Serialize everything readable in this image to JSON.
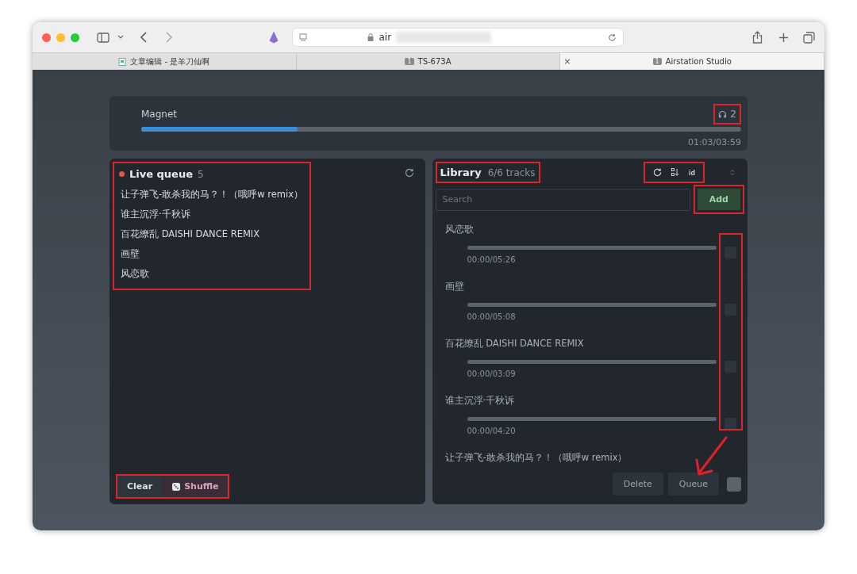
{
  "browser": {
    "address": "air",
    "tabs": [
      {
        "title": "文章编辑 - 是羊刀仙啊",
        "selected": false
      },
      {
        "title": "TS-673A",
        "selected": false,
        "badge": "1"
      },
      {
        "title": "Airstation Studio",
        "selected": true,
        "badge": "1",
        "close": "×"
      }
    ]
  },
  "player": {
    "title": "Magnet",
    "listeners": "2",
    "level": 0.26,
    "time": "01:03/03:59"
  },
  "queue": {
    "title": "Live queue",
    "live": true,
    "count": "5",
    "items": [
      "让子弹飞-敢杀我的马？！（哦呼w remix）",
      "谁主沉浮·千秋诉",
      "百花缭乱 DAISHI DANCE REMIX",
      "画壁",
      "风恋歌"
    ],
    "buttons": [
      "Clear",
      "Shuffle"
    ]
  },
  "library": {
    "title": "Library",
    "count": "6/6 tracks",
    "sort_label": "id",
    "search": {
      "placeholder": "Search"
    },
    "add_button": "Add",
    "tracks": [
      {
        "name": "风恋歌",
        "time": "00:00/05:26",
        "level": 0,
        "checked": false
      },
      {
        "name": "画壁",
        "time": "00:00/05:08",
        "level": 0,
        "checked": false
      },
      {
        "name": "百花缭乱 DAISHI DANCE REMIX",
        "time": "00:00/03:09",
        "level": 0,
        "checked": false
      },
      {
        "name": "谁主沉浮·千秋诉",
        "time": "00:00/04:20",
        "level": 0,
        "checked": false
      },
      {
        "name": "让子弹飞-敢杀我的马？！（哦呼w remix）"
      }
    ],
    "buttons": [
      "Delete",
      "Queue"
    ],
    "select_all": false
  }
}
